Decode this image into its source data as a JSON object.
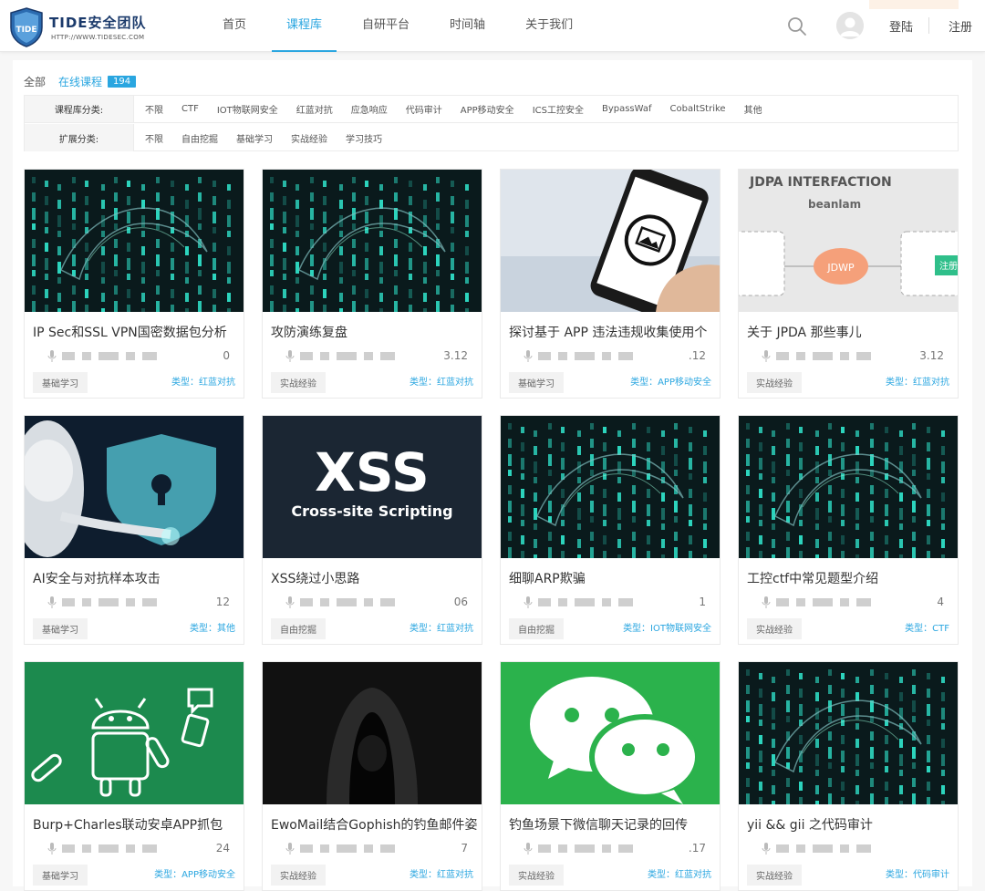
{
  "header": {
    "logo_title": "TIDE安全团队",
    "logo_sub": "HTTP://WWW.TIDESEC.COM",
    "nav": [
      "首页",
      "课程库",
      "自研平台",
      "时间轴",
      "关于我们"
    ],
    "active_nav": "课程库",
    "login": "登陆",
    "register": "注册"
  },
  "filters": {
    "all": "全部",
    "online": "在线课程",
    "count": "194",
    "category_label": "课程库分类:",
    "categories": [
      "不限",
      "CTF",
      "IOT物联网安全",
      "红蓝对抗",
      "应急响应",
      "代码审计",
      "APP移动安全",
      "ICS工控安全",
      "BypassWaf",
      "CobaltStrike",
      "其他"
    ],
    "ext_label": "扩展分类:",
    "ext": [
      "不限",
      "自由挖掘",
      "基础学习",
      "实战经验",
      "学习技巧"
    ]
  },
  "cards": [
    {
      "title": "IP Sec和SSL VPN国密数据包分析",
      "meta_tail": "0",
      "tag": "基础学习",
      "type": "类型：红蓝对抗",
      "thumb": "matrix-hacker"
    },
    {
      "title": "攻防演练复盘",
      "meta_tail": "3.12",
      "tag": "实战经验",
      "type": "类型：红蓝对抗",
      "thumb": "matrix-hacker"
    },
    {
      "title": "探讨基于 APP 违法违规收集使用个",
      "meta_tail": ".12",
      "tag": "基础学习",
      "type": "类型：APP移动安全",
      "thumb": "phone"
    },
    {
      "title": "关于 JPDA 那些事儿",
      "meta_tail": "3.12",
      "tag": "实战经验",
      "type": "类型：红蓝对抗",
      "thumb": "jdpa"
    },
    {
      "title": "AI安全与对抗样本攻击",
      "meta_tail": "12",
      "tag": "基础学习",
      "type": "类型：其他",
      "thumb": "robot"
    },
    {
      "title": "XSS绕过小思路",
      "meta_tail": "06",
      "tag": "自由挖掘",
      "type": "类型：红蓝对抗",
      "thumb": "xss"
    },
    {
      "title": "细聊ARP欺骗",
      "meta_tail": "1",
      "tag": "自由挖掘",
      "type": "类型：IOT物联网安全",
      "thumb": "matrix-hacker"
    },
    {
      "title": "工控ctf中常见题型介绍",
      "meta_tail": "4",
      "tag": "实战经验",
      "type": "类型：CTF",
      "thumb": "matrix-hacker"
    },
    {
      "title": "Burp+Charles联动安卓APP抓包",
      "meta_tail": "24",
      "tag": "基础学习",
      "type": "类型：APP移动安全",
      "thumb": "android"
    },
    {
      "title": "EwoMail结合Gophish的钓鱼邮件姿",
      "meta_tail": "7",
      "tag": "实战经验",
      "type": "类型：红蓝对抗",
      "thumb": "hoodie"
    },
    {
      "title": "钓鱼场景下微信聊天记录的回传",
      "meta_tail": ".17",
      "tag": "实战经验",
      "type": "类型：红蓝对抗",
      "thumb": "wechat"
    },
    {
      "title": "yii && gii 之代码审计",
      "meta_tail": "",
      "tag": "实战经验",
      "type": "类型：代码审计",
      "thumb": "matrix-hacker"
    }
  ],
  "thumb_text": {
    "jdpa_title": "JDPA INTERFACTION",
    "jdpa_author": "beanlam",
    "jdpa_node": "JDWP",
    "jdpa_btn": "注册",
    "xss_big": "XSS",
    "xss_sub": "Cross-site Scripting"
  },
  "colors": {
    "accent": "#2aa6e0",
    "matrix": "#2fe0c8",
    "android_bg": "#1c8a4e",
    "wechat_bg": "#2bb24c"
  }
}
